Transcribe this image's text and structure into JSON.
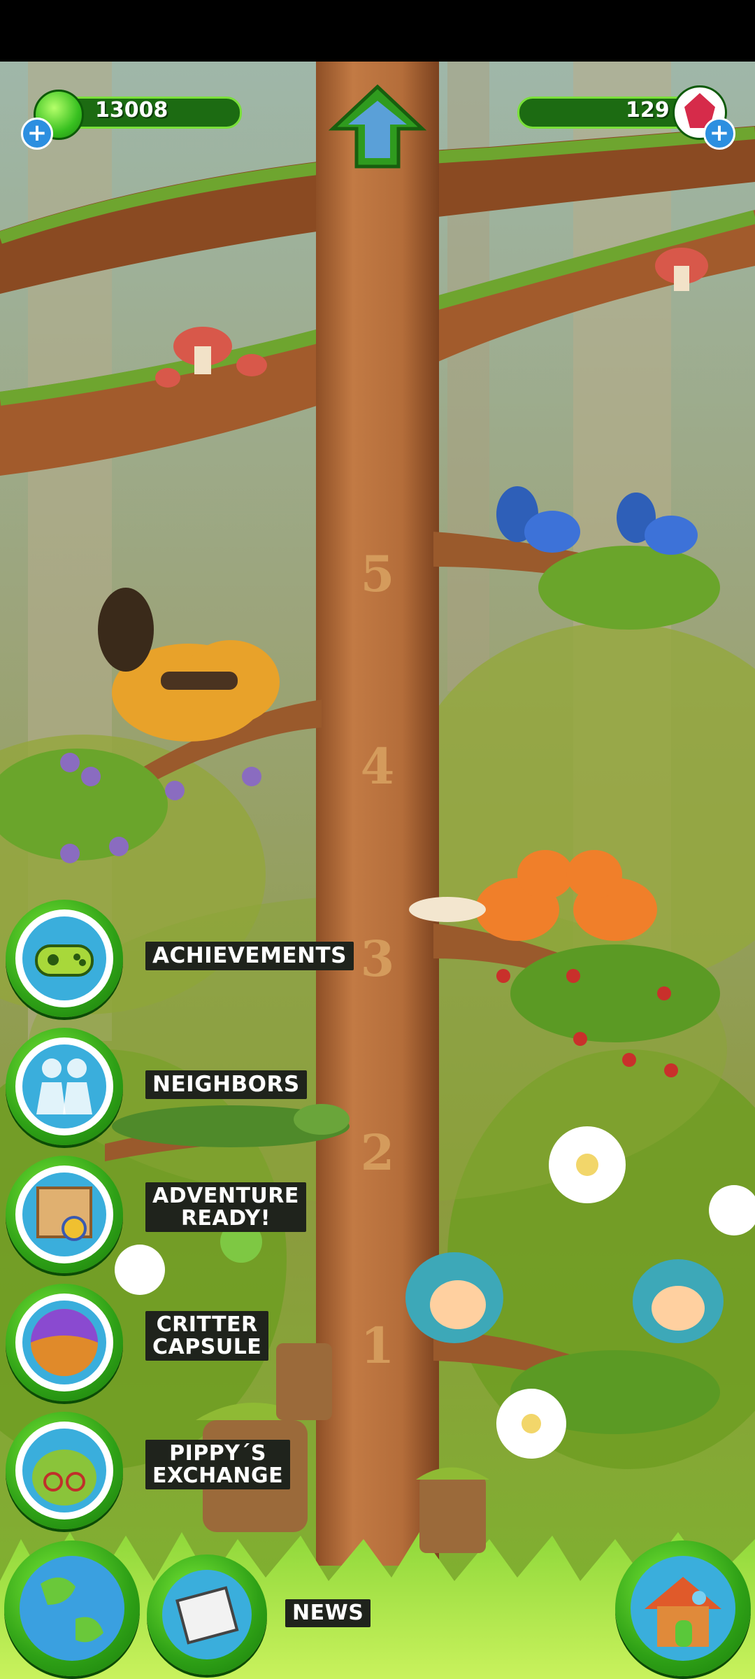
{
  "hud": {
    "gems_green": "13008",
    "gems_red": "129"
  },
  "tree": {
    "levels": [
      "5",
      "4",
      "3",
      "2",
      "1"
    ]
  },
  "menu": {
    "achievements": "ACHIEVEMENTS",
    "neighbors": "NEIGHBORS",
    "adventure_line1": "ADVENTURE",
    "adventure_line2": "READY!",
    "capsule_line1": "CRITTER",
    "capsule_line2": "CAPSULE",
    "exchange_line1": "PIPPY´S",
    "exchange_line2": "EXCHANGE",
    "news": "NEWS"
  },
  "icons": {
    "gem_green": "green-gem-icon",
    "gem_red": "red-gem-icon",
    "plus": "plus-icon",
    "up": "up-arrow-icon",
    "achievements": "gamepad-icon",
    "neighbors": "neighbors-icon",
    "adventure": "map-compass-icon",
    "capsule": "capsule-icon",
    "exchange": "pippy-icon",
    "globe": "globe-icon",
    "news": "newspaper-icon",
    "home": "house-icon"
  },
  "colors": {
    "hud_bar": "#1c6b12",
    "button_green": "#2ea016",
    "label_bg": "#1f231c",
    "trunk": "#b06a3a"
  }
}
